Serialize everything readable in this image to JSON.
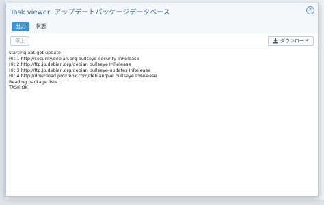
{
  "window": {
    "title": "Task viewer: アップデートパッケージデータベース"
  },
  "tabs": [
    {
      "label": "出力",
      "active": true
    },
    {
      "label": "状態",
      "active": false
    }
  ],
  "toolbar": {
    "stop_label": "停止",
    "download_label": "ダウンロード",
    "download_icon": "download-icon"
  },
  "log": {
    "lines": [
      "starting apt-get update",
      "Hit:1 http://security.debian.org bullseye-security InRelease",
      "Hit:2 http://ftp.jp.debian.org/debian bullseye InRelease",
      "Hit:3 http://ftp.jp.debian.org/debian bullseye-updates InRelease",
      "Hit:4 http://download.proxmox.com/debian/pve bullseye InRelease",
      "Reading package lists...",
      "TASK OK"
    ]
  },
  "colors": {
    "accent": "#3892d4",
    "title": "#3d6a95"
  }
}
